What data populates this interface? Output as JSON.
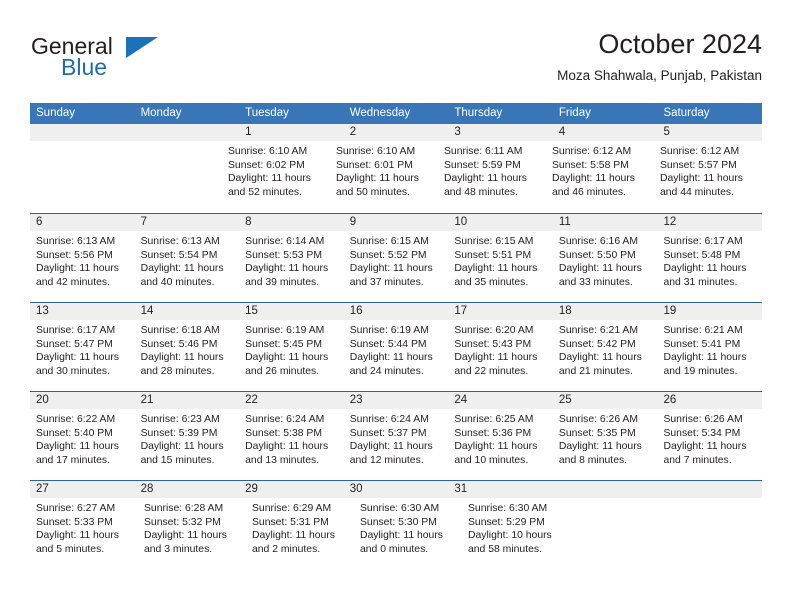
{
  "brand": {
    "name_part1": "General",
    "name_part2": "Blue",
    "triangle_color": "#1c72b8",
    "blue_text_color": "#1f6cb4"
  },
  "header": {
    "title": "October 2024",
    "subtitle": "Moza Shahwala, Punjab, Pakistan"
  },
  "theme": {
    "header_row_bg": "#3876b8",
    "header_row_text": "#ffffff",
    "week_separator": "#2a62a3",
    "daynum_band_bg": "#efefef",
    "body_text": "#231f20"
  },
  "weekdays": [
    "Sunday",
    "Monday",
    "Tuesday",
    "Wednesday",
    "Thursday",
    "Friday",
    "Saturday"
  ],
  "weeks": [
    {
      "days": [
        {
          "num": "",
          "empty": true,
          "lines": []
        },
        {
          "num": "",
          "empty": true,
          "lines": []
        },
        {
          "num": "1",
          "empty": false,
          "lines": [
            "Sunrise: 6:10 AM",
            "Sunset: 6:02 PM",
            "Daylight: 11 hours and 52 minutes."
          ]
        },
        {
          "num": "2",
          "empty": false,
          "lines": [
            "Sunrise: 6:10 AM",
            "Sunset: 6:01 PM",
            "Daylight: 11 hours and 50 minutes."
          ]
        },
        {
          "num": "3",
          "empty": false,
          "lines": [
            "Sunrise: 6:11 AM",
            "Sunset: 5:59 PM",
            "Daylight: 11 hours and 48 minutes."
          ]
        },
        {
          "num": "4",
          "empty": false,
          "lines": [
            "Sunrise: 6:12 AM",
            "Sunset: 5:58 PM",
            "Daylight: 11 hours and 46 minutes."
          ]
        },
        {
          "num": "5",
          "empty": false,
          "lines": [
            "Sunrise: 6:12 AM",
            "Sunset: 5:57 PM",
            "Daylight: 11 hours and 44 minutes."
          ]
        }
      ]
    },
    {
      "days": [
        {
          "num": "6",
          "empty": false,
          "lines": [
            "Sunrise: 6:13 AM",
            "Sunset: 5:56 PM",
            "Daylight: 11 hours and 42 minutes."
          ]
        },
        {
          "num": "7",
          "empty": false,
          "lines": [
            "Sunrise: 6:13 AM",
            "Sunset: 5:54 PM",
            "Daylight: 11 hours and 40 minutes."
          ]
        },
        {
          "num": "8",
          "empty": false,
          "lines": [
            "Sunrise: 6:14 AM",
            "Sunset: 5:53 PM",
            "Daylight: 11 hours and 39 minutes."
          ]
        },
        {
          "num": "9",
          "empty": false,
          "lines": [
            "Sunrise: 6:15 AM",
            "Sunset: 5:52 PM",
            "Daylight: 11 hours and 37 minutes."
          ]
        },
        {
          "num": "10",
          "empty": false,
          "lines": [
            "Sunrise: 6:15 AM",
            "Sunset: 5:51 PM",
            "Daylight: 11 hours and 35 minutes."
          ]
        },
        {
          "num": "11",
          "empty": false,
          "lines": [
            "Sunrise: 6:16 AM",
            "Sunset: 5:50 PM",
            "Daylight: 11 hours and 33 minutes."
          ]
        },
        {
          "num": "12",
          "empty": false,
          "lines": [
            "Sunrise: 6:17 AM",
            "Sunset: 5:48 PM",
            "Daylight: 11 hours and 31 minutes."
          ]
        }
      ]
    },
    {
      "days": [
        {
          "num": "13",
          "empty": false,
          "lines": [
            "Sunrise: 6:17 AM",
            "Sunset: 5:47 PM",
            "Daylight: 11 hours and 30 minutes."
          ]
        },
        {
          "num": "14",
          "empty": false,
          "lines": [
            "Sunrise: 6:18 AM",
            "Sunset: 5:46 PM",
            "Daylight: 11 hours and 28 minutes."
          ]
        },
        {
          "num": "15",
          "empty": false,
          "lines": [
            "Sunrise: 6:19 AM",
            "Sunset: 5:45 PM",
            "Daylight: 11 hours and 26 minutes."
          ]
        },
        {
          "num": "16",
          "empty": false,
          "lines": [
            "Sunrise: 6:19 AM",
            "Sunset: 5:44 PM",
            "Daylight: 11 hours and 24 minutes."
          ]
        },
        {
          "num": "17",
          "empty": false,
          "lines": [
            "Sunrise: 6:20 AM",
            "Sunset: 5:43 PM",
            "Daylight: 11 hours and 22 minutes."
          ]
        },
        {
          "num": "18",
          "empty": false,
          "lines": [
            "Sunrise: 6:21 AM",
            "Sunset: 5:42 PM",
            "Daylight: 11 hours and 21 minutes."
          ]
        },
        {
          "num": "19",
          "empty": false,
          "lines": [
            "Sunrise: 6:21 AM",
            "Sunset: 5:41 PM",
            "Daylight: 11 hours and 19 minutes."
          ]
        }
      ]
    },
    {
      "days": [
        {
          "num": "20",
          "empty": false,
          "lines": [
            "Sunrise: 6:22 AM",
            "Sunset: 5:40 PM",
            "Daylight: 11 hours and 17 minutes."
          ]
        },
        {
          "num": "21",
          "empty": false,
          "lines": [
            "Sunrise: 6:23 AM",
            "Sunset: 5:39 PM",
            "Daylight: 11 hours and 15 minutes."
          ]
        },
        {
          "num": "22",
          "empty": false,
          "lines": [
            "Sunrise: 6:24 AM",
            "Sunset: 5:38 PM",
            "Daylight: 11 hours and 13 minutes."
          ]
        },
        {
          "num": "23",
          "empty": false,
          "lines": [
            "Sunrise: 6:24 AM",
            "Sunset: 5:37 PM",
            "Daylight: 11 hours and 12 minutes."
          ]
        },
        {
          "num": "24",
          "empty": false,
          "lines": [
            "Sunrise: 6:25 AM",
            "Sunset: 5:36 PM",
            "Daylight: 11 hours and 10 minutes."
          ]
        },
        {
          "num": "25",
          "empty": false,
          "lines": [
            "Sunrise: 6:26 AM",
            "Sunset: 5:35 PM",
            "Daylight: 11 hours and 8 minutes."
          ]
        },
        {
          "num": "26",
          "empty": false,
          "lines": [
            "Sunrise: 6:26 AM",
            "Sunset: 5:34 PM",
            "Daylight: 11 hours and 7 minutes."
          ]
        }
      ]
    },
    {
      "days": [
        {
          "num": "27",
          "empty": false,
          "lines": [
            "Sunrise: 6:27 AM",
            "Sunset: 5:33 PM",
            "Daylight: 11 hours and 5 minutes."
          ]
        },
        {
          "num": "28",
          "empty": false,
          "lines": [
            "Sunrise: 6:28 AM",
            "Sunset: 5:32 PM",
            "Daylight: 11 hours and 3 minutes."
          ]
        },
        {
          "num": "29",
          "empty": false,
          "lines": [
            "Sunrise: 6:29 AM",
            "Sunset: 5:31 PM",
            "Daylight: 11 hours and 2 minutes."
          ]
        },
        {
          "num": "30",
          "empty": false,
          "lines": [
            "Sunrise: 6:30 AM",
            "Sunset: 5:30 PM",
            "Daylight: 11 hours and 0 minutes."
          ]
        },
        {
          "num": "31",
          "empty": false,
          "lines": [
            "Sunrise: 6:30 AM",
            "Sunset: 5:29 PM",
            "Daylight: 10 hours and 58 minutes."
          ]
        },
        {
          "num": "",
          "empty": true,
          "lines": []
        },
        {
          "num": "",
          "empty": true,
          "lines": []
        }
      ]
    }
  ]
}
